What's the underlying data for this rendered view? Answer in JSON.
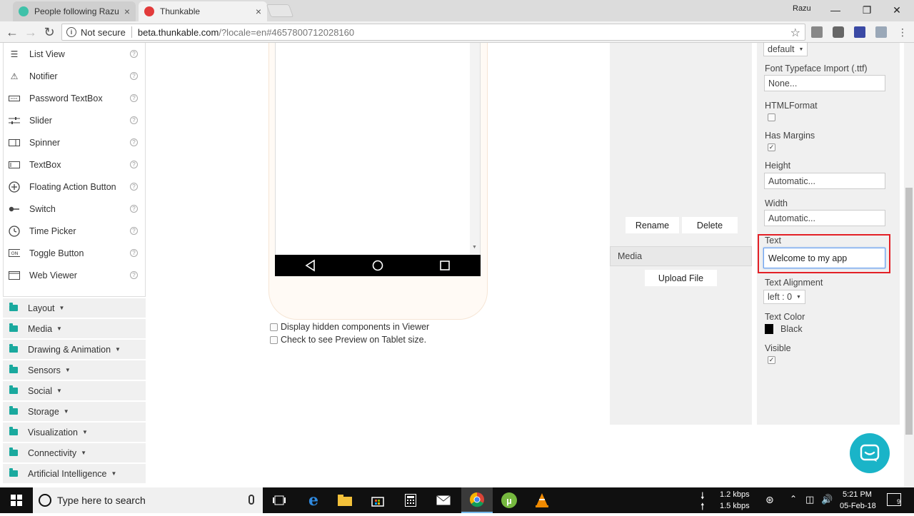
{
  "browser": {
    "tabs": [
      {
        "title": "People following Razu Ah",
        "active": false
      },
      {
        "title": "Thunkable",
        "active": true
      }
    ],
    "profile_name": "Razu",
    "security_label": "Not secure",
    "url_host": "beta.thunkable.com",
    "url_path": "/?locale=en#4657800712028160"
  },
  "palette": {
    "items": [
      {
        "label": "List View",
        "icon": "list-icon"
      },
      {
        "label": "Notifier",
        "icon": "warning-icon"
      },
      {
        "label": "Password TextBox",
        "icon": "password-icon"
      },
      {
        "label": "Slider",
        "icon": "slider-icon"
      },
      {
        "label": "Spinner",
        "icon": "spinner-icon"
      },
      {
        "label": "TextBox",
        "icon": "textbox-icon"
      },
      {
        "label": "Floating Action Button",
        "icon": "plus-circle-icon"
      },
      {
        "label": "Switch",
        "icon": "switch-icon"
      },
      {
        "label": "Time Picker",
        "icon": "clock-icon"
      },
      {
        "label": "Toggle Button",
        "icon": "toggle-on-icon"
      },
      {
        "label": "Web Viewer",
        "icon": "browser-window-icon"
      }
    ],
    "help_glyph": "?",
    "categories": [
      "Layout",
      "Media",
      "Drawing & Animation",
      "Sensors",
      "Social",
      "Storage",
      "Visualization",
      "Connectivity",
      "Artificial Intelligence"
    ]
  },
  "viewer": {
    "option_hidden": "Display hidden components in Viewer",
    "option_tablet": "Check to see Preview on Tablet size."
  },
  "media": {
    "rename_label": "Rename",
    "delete_label": "Delete",
    "header": "Media",
    "upload_label": "Upload File"
  },
  "properties": {
    "font_size_value": "default",
    "font_typeface_label": "Font Typeface Import (.ttf)",
    "font_typeface_value": "None...",
    "html_format_label": "HTMLFormat",
    "html_format_checked": false,
    "has_margins_label": "Has Margins",
    "has_margins_checked": true,
    "height_label": "Height",
    "height_value": "Automatic...",
    "width_label": "Width",
    "width_value": "Automatic...",
    "text_label": "Text",
    "text_value": "Welcome to my app",
    "text_alignment_label": "Text Alignment",
    "text_alignment_value": "left : 0",
    "text_color_label": "Text Color",
    "text_color_value": "Black",
    "text_color_hex": "#000000",
    "visible_label": "Visible",
    "visible_checked": true
  },
  "colors": {
    "accent_teal": "#1aa99e",
    "chat_bubble": "#1ab4c8",
    "highlight_red": "#e32026"
  },
  "taskbar": {
    "search_placeholder": "Type here to search",
    "net_down": "1.2 kbps",
    "net_up": "1.5 kbps",
    "time": "5:21 PM",
    "date": "05-Feb-18",
    "notification_count": "9"
  }
}
